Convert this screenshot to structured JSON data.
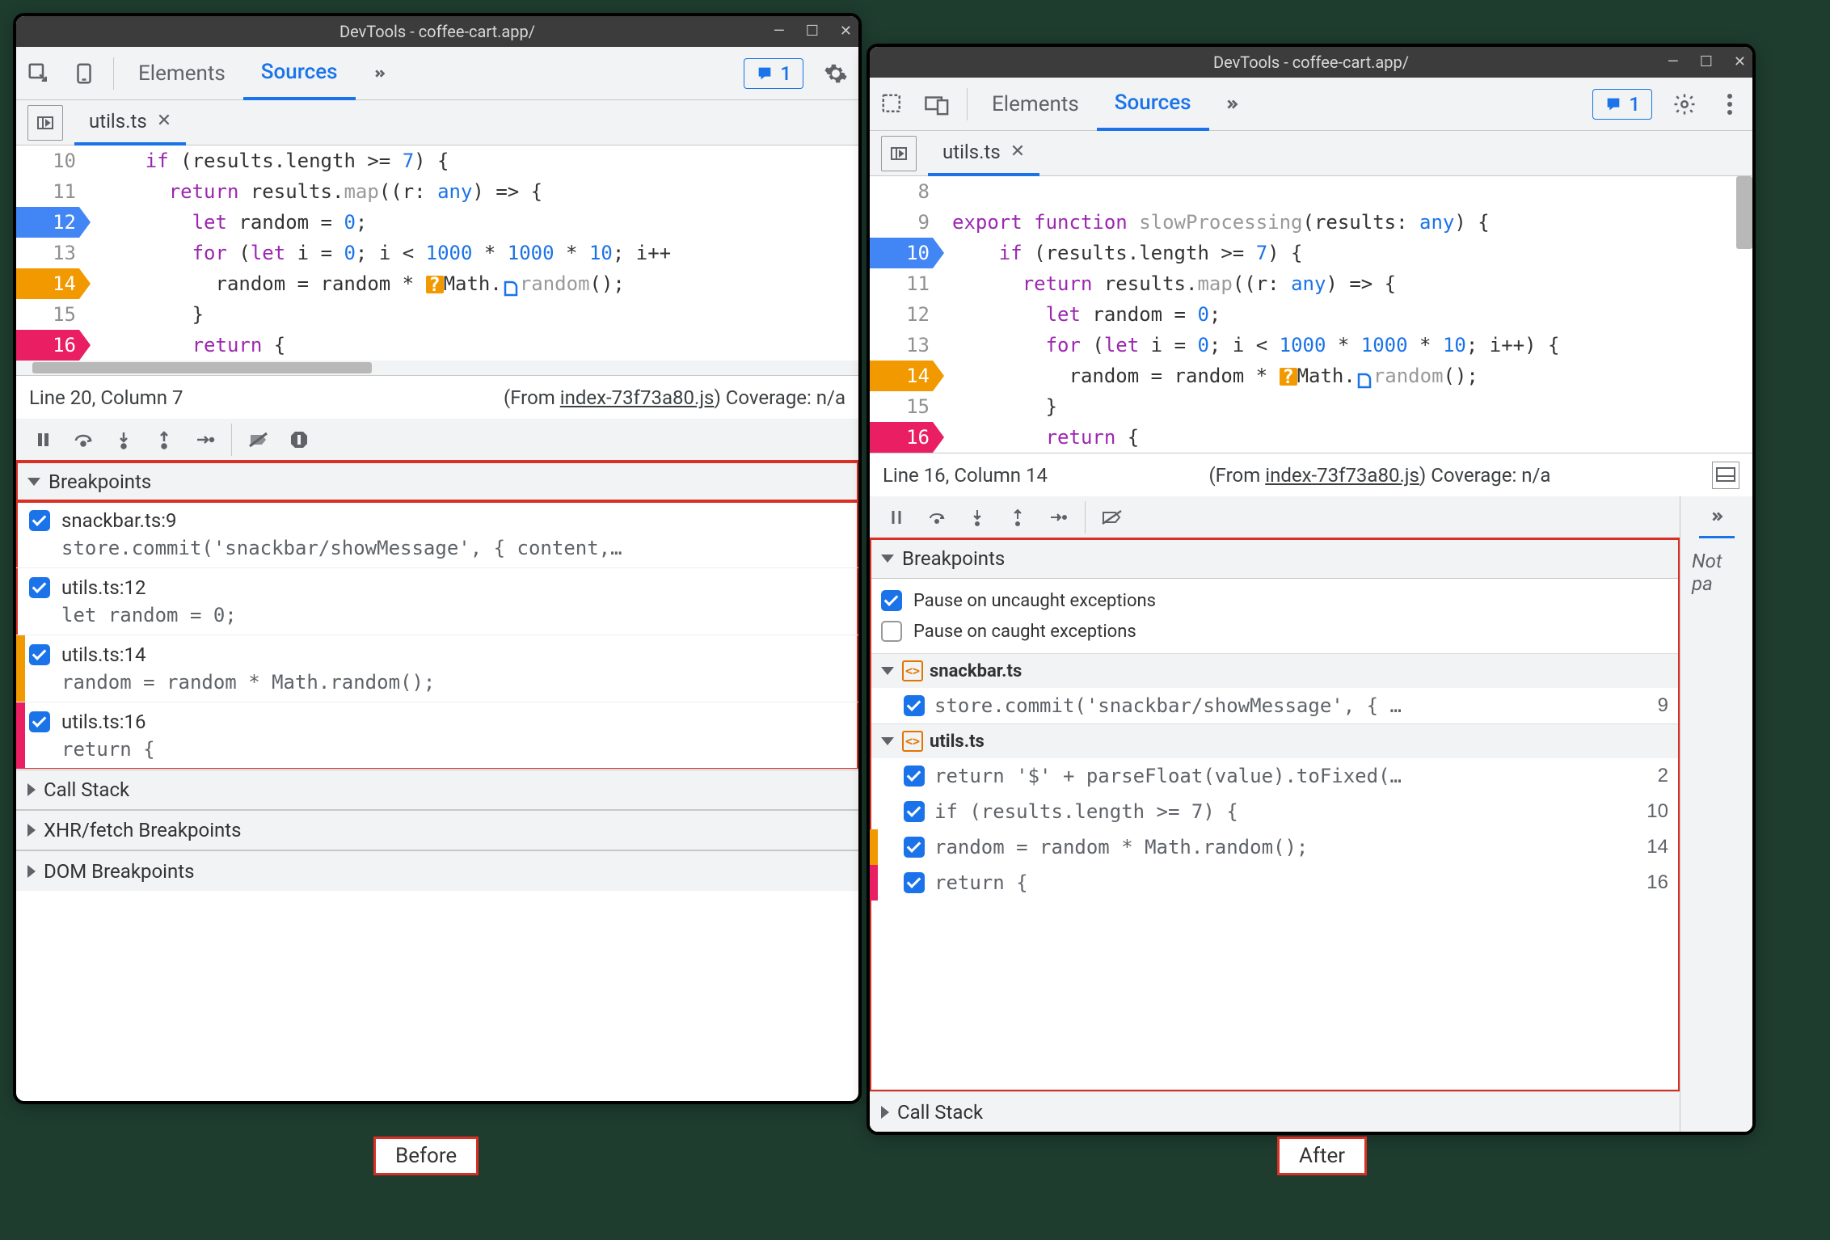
{
  "before": {
    "title": "DevTools - coffee-cart.app/",
    "tabs": {
      "elements": "Elements",
      "sources": "Sources"
    },
    "msgcount": "1",
    "file": "utils.ts",
    "code": [
      {
        "n": "10",
        "m": "",
        "t": "  if (results.length >= 7) {",
        "toks": [
          [
            "    ",
            ""
          ],
          [
            "if",
            1
          ],
          [
            " (results.length >= ",
            0
          ],
          [
            "7",
            2
          ],
          [
            ") {",
            0
          ]
        ]
      },
      {
        "n": "11",
        "m": "",
        "t": "    return results.map((r: any) => {",
        "toks": [
          [
            "      ",
            ""
          ],
          [
            "return",
            1
          ],
          [
            " results.",
            0
          ],
          [
            "map",
            3
          ],
          [
            "((r: ",
            0
          ],
          [
            "any",
            2
          ],
          [
            ") => {",
            0
          ]
        ]
      },
      {
        "n": "12",
        "m": "blue",
        "t": "      let random = 0;",
        "toks": [
          [
            "        ",
            ""
          ],
          [
            "let",
            1
          ],
          [
            " random = ",
            0
          ],
          [
            "0",
            2
          ],
          [
            ";",
            0
          ]
        ]
      },
      {
        "n": "13",
        "m": "",
        "t": "      for (let i = 0; i < 1000 * 1000 * 10; i++",
        "toks": [
          [
            "        ",
            ""
          ],
          [
            "for",
            1
          ],
          [
            " (",
            0
          ],
          [
            "let",
            1
          ],
          [
            " i = ",
            0
          ],
          [
            "0",
            2
          ],
          [
            "; i < ",
            0
          ],
          [
            "1000",
            2
          ],
          [
            " * ",
            0
          ],
          [
            "1000",
            2
          ],
          [
            " * ",
            0
          ],
          [
            "10",
            2
          ],
          [
            "; i++",
            0
          ]
        ]
      },
      {
        "n": "14",
        "m": "orange",
        "q": true,
        "t": "        random = random * Math.random();",
        "toks": [
          [
            "          random = random * ",
            0
          ],
          [
            "@o",
            4
          ],
          [
            "Math.",
            0
          ],
          [
            "@d",
            5
          ],
          [
            "random",
            3
          ],
          [
            "();",
            0
          ]
        ]
      },
      {
        "n": "15",
        "m": "",
        "t": "      }",
        "toks": [
          [
            "        }",
            0
          ]
        ]
      },
      {
        "n": "16",
        "m": "mag",
        "d": true,
        "t": "      return {",
        "toks": [
          [
            "        ",
            ""
          ],
          [
            "return",
            1
          ],
          [
            " {",
            0
          ]
        ]
      }
    ],
    "status": {
      "pos": "Line 20, Column 7",
      "from": "(From ",
      "src": "index-73f73a80.js",
      "cov": ")  Coverage: n/a"
    },
    "sections": {
      "bp": "Breakpoints",
      "cs": "Call Stack",
      "xhr": "XHR/fetch Breakpoints",
      "dom": "DOM Breakpoints"
    },
    "breakpoints": [
      {
        "f": "snackbar.ts:9",
        "c": "store.commit('snackbar/showMessage', { content,…"
      },
      {
        "f": "utils.ts:12",
        "c": "let random = 0;"
      },
      {
        "f": "utils.ts:14",
        "c": "random = random * Math.random();",
        "strip": "#f29900"
      },
      {
        "f": "utils.ts:16",
        "c": "return {",
        "strip": "#e91e63"
      }
    ],
    "label": "Before"
  },
  "after": {
    "title": "DevTools - coffee-cart.app/",
    "tabs": {
      "elements": "Elements",
      "sources": "Sources"
    },
    "msgcount": "1",
    "file": "utils.ts",
    "code": [
      {
        "n": "8",
        "m": "",
        "toks": [
          [
            "",
            0
          ]
        ]
      },
      {
        "n": "9",
        "m": "",
        "toks": [
          [
            "",
            ""
          ],
          [
            "export",
            1
          ],
          [
            " ",
            0
          ],
          [
            "function",
            1
          ],
          [
            " ",
            0
          ],
          [
            "slowProcessing",
            3
          ],
          [
            "(results: ",
            0
          ],
          [
            "any",
            2
          ],
          [
            ") {",
            0
          ]
        ]
      },
      {
        "n": "10",
        "m": "blue",
        "toks": [
          [
            "    ",
            ""
          ],
          [
            "if",
            1
          ],
          [
            " (results.length >= ",
            0
          ],
          [
            "7",
            2
          ],
          [
            ") {",
            0
          ]
        ]
      },
      {
        "n": "11",
        "m": "",
        "toks": [
          [
            "      ",
            ""
          ],
          [
            "return",
            1
          ],
          [
            " results.",
            0
          ],
          [
            "map",
            3
          ],
          [
            "((r: ",
            0
          ],
          [
            "any",
            2
          ],
          [
            ") => {",
            0
          ]
        ]
      },
      {
        "n": "12",
        "m": "",
        "toks": [
          [
            "        ",
            ""
          ],
          [
            "let",
            1
          ],
          [
            " random = ",
            0
          ],
          [
            "0",
            2
          ],
          [
            ";",
            0
          ]
        ]
      },
      {
        "n": "13",
        "m": "",
        "toks": [
          [
            "        ",
            ""
          ],
          [
            "for",
            1
          ],
          [
            " (",
            0
          ],
          [
            "let",
            1
          ],
          [
            " i = ",
            0
          ],
          [
            "0",
            2
          ],
          [
            "; i < ",
            0
          ],
          [
            "1000",
            2
          ],
          [
            " * ",
            0
          ],
          [
            "1000",
            2
          ],
          [
            " * ",
            0
          ],
          [
            "10",
            2
          ],
          [
            "; i++) {",
            0
          ]
        ]
      },
      {
        "n": "14",
        "m": "orange",
        "q": true,
        "toks": [
          [
            "          random = random * ",
            0
          ],
          [
            "@o",
            4
          ],
          [
            "Math.",
            0
          ],
          [
            "@d",
            5
          ],
          [
            "random",
            3
          ],
          [
            "();",
            0
          ]
        ]
      },
      {
        "n": "15",
        "m": "",
        "toks": [
          [
            "        }",
            0
          ]
        ]
      },
      {
        "n": "16",
        "m": "mag",
        "d": true,
        "toks": [
          [
            "        ",
            ""
          ],
          [
            "return",
            1
          ],
          [
            " {",
            0
          ]
        ]
      }
    ],
    "status": {
      "pos": "Line 16, Column 14",
      "from": "(From ",
      "src": "index-73f73a80.js",
      "cov": ")  Coverage: n/a"
    },
    "sections": {
      "bp": "Breakpoints",
      "cs": "Call Stack"
    },
    "pauseopts": [
      {
        "on": true,
        "t": "Pause on uncaught exceptions"
      },
      {
        "on": false,
        "t": "Pause on caught exceptions"
      }
    ],
    "groups": [
      {
        "f": "snackbar.ts",
        "items": [
          {
            "c": "store.commit('snackbar/showMessage', { …",
            "n": "9"
          }
        ]
      },
      {
        "f": "utils.ts",
        "items": [
          {
            "c": "return '$' + parseFloat(value).toFixed(…",
            "n": "2"
          },
          {
            "c": "if (results.length >= 7) {",
            "n": "10"
          },
          {
            "c": "random = random * Math.random();",
            "n": "14",
            "strip": "#f29900"
          },
          {
            "c": "return {",
            "n": "16",
            "strip": "#e91e63"
          }
        ]
      }
    ],
    "notpaused": "Not pa",
    "label": "After"
  }
}
